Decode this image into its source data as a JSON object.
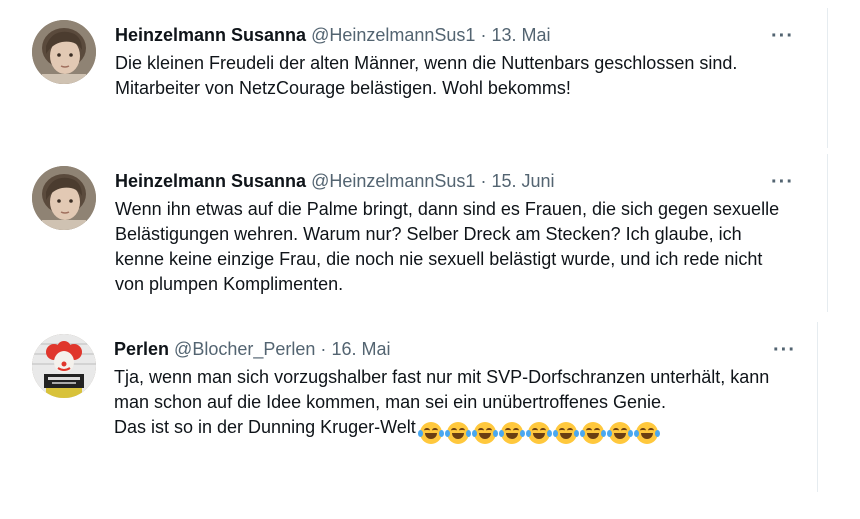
{
  "tweets": [
    {
      "name": "Heinzelmann Susanna",
      "handle": "@HeinzelmannSus1",
      "separator": "·",
      "date": "13. Mai",
      "more": "···",
      "avatar_icon": "portrait-avatar",
      "lines": [
        "Die kleinen Freudeli der alten Männer, wenn die Nuttenbars geschlossen sind.",
        "Mitarbeiter von NetzCourage belästigen. Wohl bekomms!"
      ]
    },
    {
      "name": "Heinzelmann Susanna",
      "handle": "@HeinzelmannSus1",
      "separator": "·",
      "date": "15. Juni",
      "more": "···",
      "avatar_icon": "portrait-avatar",
      "lines": [
        "Wenn ihn etwas auf die Palme bringt, dann sind es Frauen, die sich gegen sexuelle Belästigungen wehren. Warum nur? Selber Dreck am Stecken? Ich glaube, ich kenne keine einzige Frau, die noch nie sexuell belästigt wurde, und ich rede nicht von plumpen Komplimenten."
      ]
    },
    {
      "name": "Perlen",
      "handle": "@Blocher_Perlen",
      "separator": "·",
      "date": "16. Mai",
      "more": "···",
      "avatar_icon": "clown-mugshot-avatar",
      "lines": [
        "Tja, wenn man sich vorzugshalber fast nur mit SVP-Dorfschranzen unterhält, kann man schon auf die Idee kommen, man sei ein unübertroffenes Genie.",
        "Das ist so in der Dunning Kruger-Welt"
      ],
      "emoji_icon": "face-with-tears-of-joy-icon",
      "emoji_count": 9
    }
  ]
}
